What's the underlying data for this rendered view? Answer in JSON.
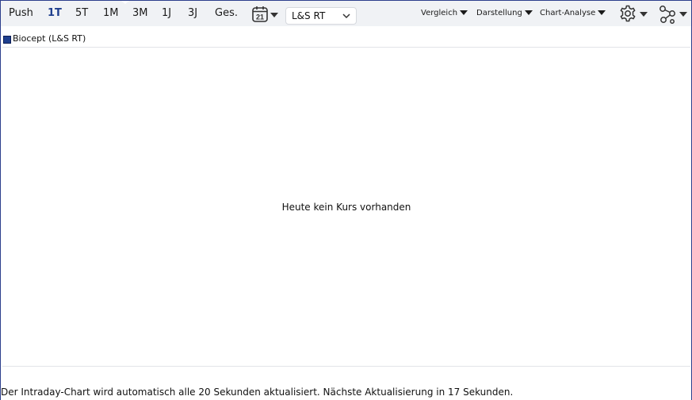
{
  "toolbar": {
    "ranges": [
      {
        "label": "Push",
        "active": false
      },
      {
        "label": "1T",
        "active": true
      },
      {
        "label": "5T",
        "active": false
      },
      {
        "label": "1M",
        "active": false
      },
      {
        "label": "3M",
        "active": false
      },
      {
        "label": "1J",
        "active": false
      },
      {
        "label": "3J",
        "active": false
      },
      {
        "label": "Ges.",
        "active": false
      }
    ],
    "calendar_day": "21",
    "exchange_select": {
      "value": "L&S RT"
    },
    "menus": {
      "compare": "Vergleich",
      "display": "Darstellung",
      "analysis": "Chart-Analyse"
    },
    "icons": [
      "calendar-icon",
      "gear-icon",
      "share-nodes-icon"
    ]
  },
  "legend": {
    "label": "Biocept (L&S RT)",
    "color": "#1f3f8e"
  },
  "chart": {
    "empty_message": "Heute kein Kurs vorhanden"
  },
  "footer": {
    "text": "Der Intraday-Chart wird automatisch alle 20 Sekunden aktualisiert. Nächste Aktualisierung in 17 Sekunden."
  }
}
